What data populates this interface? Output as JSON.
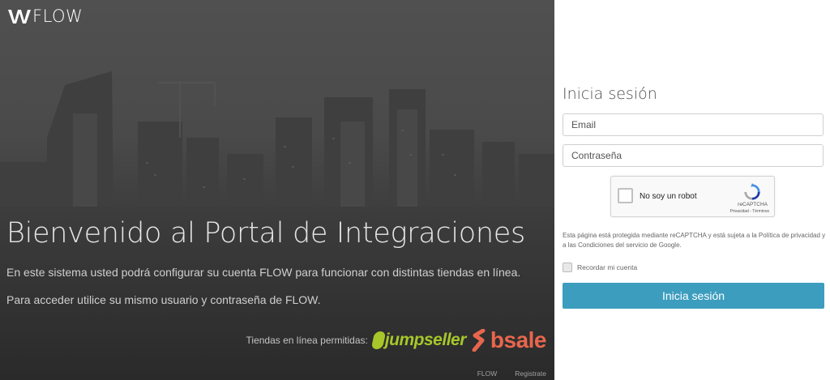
{
  "brand": {
    "logo_text": "FLOW"
  },
  "hero": {
    "title": "Bienvenido al Portal de Integraciones",
    "paragraph_1": "En este sistema usted podrá configurar su cuenta FLOW para funcionar con distintas tiendas en línea.",
    "paragraph_2": "Para acceder utilice su mismo usuario y contraseña de FLOW.",
    "stores_label": "Tiendas en línea permitidas:",
    "stores": [
      "jumpseller",
      "bsale"
    ]
  },
  "footer": {
    "links": [
      "FLOW",
      "Registrate"
    ]
  },
  "login": {
    "title": "Inicia sesión",
    "email_placeholder": "Email",
    "email_value": "",
    "password_placeholder": "Contraseña",
    "password_value": "",
    "captcha": {
      "label": "No soy un robot",
      "brand": "reCAPTCHA",
      "links": "Privacidad - Términos"
    },
    "notice": "Esta página está protegida mediante reCAPTCHA y está sujeta a la Política de privacidad y a las Condiciones del servicio de Google.",
    "remember_label": "Recordar mi cuenta",
    "submit_label": "Inicia sesión"
  },
  "colors": {
    "accent": "#3c9dbe",
    "jumpseller": "#a7c72a",
    "bsale": "#e8664d"
  }
}
